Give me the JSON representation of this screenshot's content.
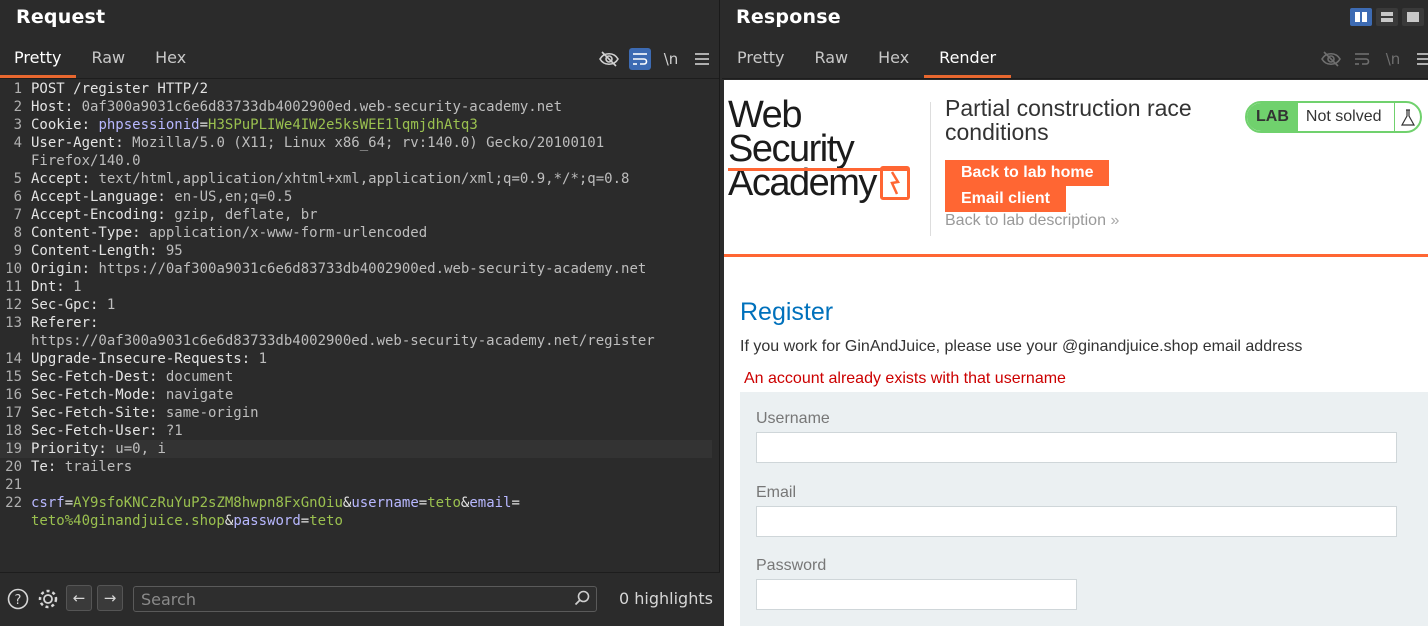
{
  "request": {
    "title": "Request",
    "tabs": [
      "Pretty",
      "Raw",
      "Hex"
    ],
    "active_tab": "Pretty",
    "newline_label": "\\n",
    "lines": [
      {
        "n": "1",
        "segments": [
          {
            "t": "POST /register HTTP/2",
            "c": "k"
          }
        ]
      },
      {
        "n": "2",
        "segments": [
          {
            "t": "Host: ",
            "c": "k"
          },
          {
            "t": "0af300a9031c6e6d83733db4002900ed.web-security-academy.net",
            "c": "v"
          }
        ]
      },
      {
        "n": "3",
        "segments": [
          {
            "t": "Cookie: ",
            "c": "k"
          },
          {
            "t": "phpsessionid",
            "c": "ck"
          },
          {
            "t": "=",
            "c": "k"
          },
          {
            "t": "H3SPuPLIWe4IW2e5ksWEE1lqmjdhAtq3",
            "c": "cv"
          }
        ]
      },
      {
        "n": "4",
        "segments": [
          {
            "t": "User-Agent: ",
            "c": "k"
          },
          {
            "t": "Mozilla/5.0 (X11; Linux x86_64; rv:140.0) Gecko/20100101",
            "c": "v"
          }
        ]
      },
      {
        "n": "",
        "segments": [
          {
            "t": "Firefox/140.0",
            "c": "v"
          }
        ]
      },
      {
        "n": "5",
        "segments": [
          {
            "t": "Accept: ",
            "c": "k"
          },
          {
            "t": "text/html,application/xhtml+xml,application/xml;q=0.9,*/*;q=0.8",
            "c": "v"
          }
        ]
      },
      {
        "n": "6",
        "segments": [
          {
            "t": "Accept-Language: ",
            "c": "k"
          },
          {
            "t": "en-US,en;q=0.5",
            "c": "v"
          }
        ]
      },
      {
        "n": "7",
        "segments": [
          {
            "t": "Accept-Encoding: ",
            "c": "k"
          },
          {
            "t": "gzip, deflate, br",
            "c": "v"
          }
        ]
      },
      {
        "n": "8",
        "segments": [
          {
            "t": "Content-Type: ",
            "c": "k"
          },
          {
            "t": "application/x-www-form-urlencoded",
            "c": "v"
          }
        ]
      },
      {
        "n": "9",
        "segments": [
          {
            "t": "Content-Length: ",
            "c": "k"
          },
          {
            "t": "95",
            "c": "v"
          }
        ]
      },
      {
        "n": "10",
        "segments": [
          {
            "t": "Origin: ",
            "c": "k"
          },
          {
            "t": "https://0af300a9031c6e6d83733db4002900ed.web-security-academy.net",
            "c": "v"
          }
        ]
      },
      {
        "n": "11",
        "segments": [
          {
            "t": "Dnt: ",
            "c": "k"
          },
          {
            "t": "1",
            "c": "v"
          }
        ]
      },
      {
        "n": "12",
        "segments": [
          {
            "t": "Sec-Gpc: ",
            "c": "k"
          },
          {
            "t": "1",
            "c": "v"
          }
        ]
      },
      {
        "n": "13",
        "segments": [
          {
            "t": "Referer: ",
            "c": "k"
          }
        ]
      },
      {
        "n": "",
        "segments": [
          {
            "t": "https://0af300a9031c6e6d83733db4002900ed.web-security-academy.net/register",
            "c": "v"
          }
        ]
      },
      {
        "n": "14",
        "segments": [
          {
            "t": "Upgrade-Insecure-Requests: ",
            "c": "k"
          },
          {
            "t": "1",
            "c": "v"
          }
        ]
      },
      {
        "n": "15",
        "segments": [
          {
            "t": "Sec-Fetch-Dest: ",
            "c": "k"
          },
          {
            "t": "document",
            "c": "v"
          }
        ]
      },
      {
        "n": "16",
        "segments": [
          {
            "t": "Sec-Fetch-Mode: ",
            "c": "k"
          },
          {
            "t": "navigate",
            "c": "v"
          }
        ]
      },
      {
        "n": "17",
        "segments": [
          {
            "t": "Sec-Fetch-Site: ",
            "c": "k"
          },
          {
            "t": "same-origin",
            "c": "v"
          }
        ]
      },
      {
        "n": "18",
        "segments": [
          {
            "t": "Sec-Fetch-User: ",
            "c": "k"
          },
          {
            "t": "?1",
            "c": "v"
          }
        ]
      },
      {
        "n": "19",
        "hl": true,
        "segments": [
          {
            "t": "Priority: ",
            "c": "k"
          },
          {
            "t": "u=0, i",
            "c": "v"
          }
        ]
      },
      {
        "n": "20",
        "segments": [
          {
            "t": "Te: ",
            "c": "k"
          },
          {
            "t": "trailers",
            "c": "v"
          }
        ]
      },
      {
        "n": "21",
        "segments": []
      },
      {
        "n": "22",
        "segments": [
          {
            "t": "csrf",
            "c": "pk"
          },
          {
            "t": "=",
            "c": "amp"
          },
          {
            "t": "AY9sfoKNCzRuYuP2sZM8hwpn8FxGnOiu",
            "c": "pv"
          },
          {
            "t": "&",
            "c": "amp"
          },
          {
            "t": "username",
            "c": "pk"
          },
          {
            "t": "=",
            "c": "amp"
          },
          {
            "t": "teto",
            "c": "pv"
          },
          {
            "t": "&",
            "c": "amp"
          },
          {
            "t": "email",
            "c": "pk"
          },
          {
            "t": "=",
            "c": "amp"
          }
        ]
      },
      {
        "n": "",
        "segments": [
          {
            "t": "teto%40ginandjuice.shop",
            "c": "pv"
          },
          {
            "t": "&",
            "c": "amp"
          },
          {
            "t": "password",
            "c": "pk"
          },
          {
            "t": "=",
            "c": "amp"
          },
          {
            "t": "teto",
            "c": "pv"
          }
        ]
      }
    ],
    "search_placeholder": "Search",
    "highlights": "0 highlights"
  },
  "response": {
    "title": "Response",
    "tabs": [
      "Pretty",
      "Raw",
      "Hex",
      "Render"
    ],
    "active_tab": "Render",
    "newline_label": "\\n",
    "render": {
      "logo_line1": "Web Security",
      "logo_line2": "Academy",
      "lab_title": "Partial construction race conditions",
      "back_home": "Back to lab home",
      "email_client": "Email client",
      "back_description": "Back to lab description",
      "badge_label": "LAB",
      "badge_status": "Not solved",
      "register_title": "Register",
      "register_subtitle": "If you work for GinAndJuice, please use your @ginandjuice.shop email address",
      "error": "An account already exists with that username",
      "username_label": "Username",
      "email_label": "Email",
      "password_label": "Password"
    }
  },
  "colors": {
    "accent_orange": "#ff6633",
    "active_tab_underline": "#e8672f",
    "toggle_blue": "#3d6bb3",
    "lab_green": "#70d16d",
    "link_blue": "#0071bc",
    "error_red": "#cc0000"
  },
  "icons": [
    "eye-slash-icon",
    "wrap-icon",
    "menu-icon",
    "help-icon",
    "gear-icon",
    "arrow-left-icon",
    "arrow-right-icon",
    "search-icon",
    "split-horizontal-icon",
    "split-vertical-icon",
    "single-pane-icon",
    "flask-icon",
    "chevron-double-right-icon"
  ]
}
